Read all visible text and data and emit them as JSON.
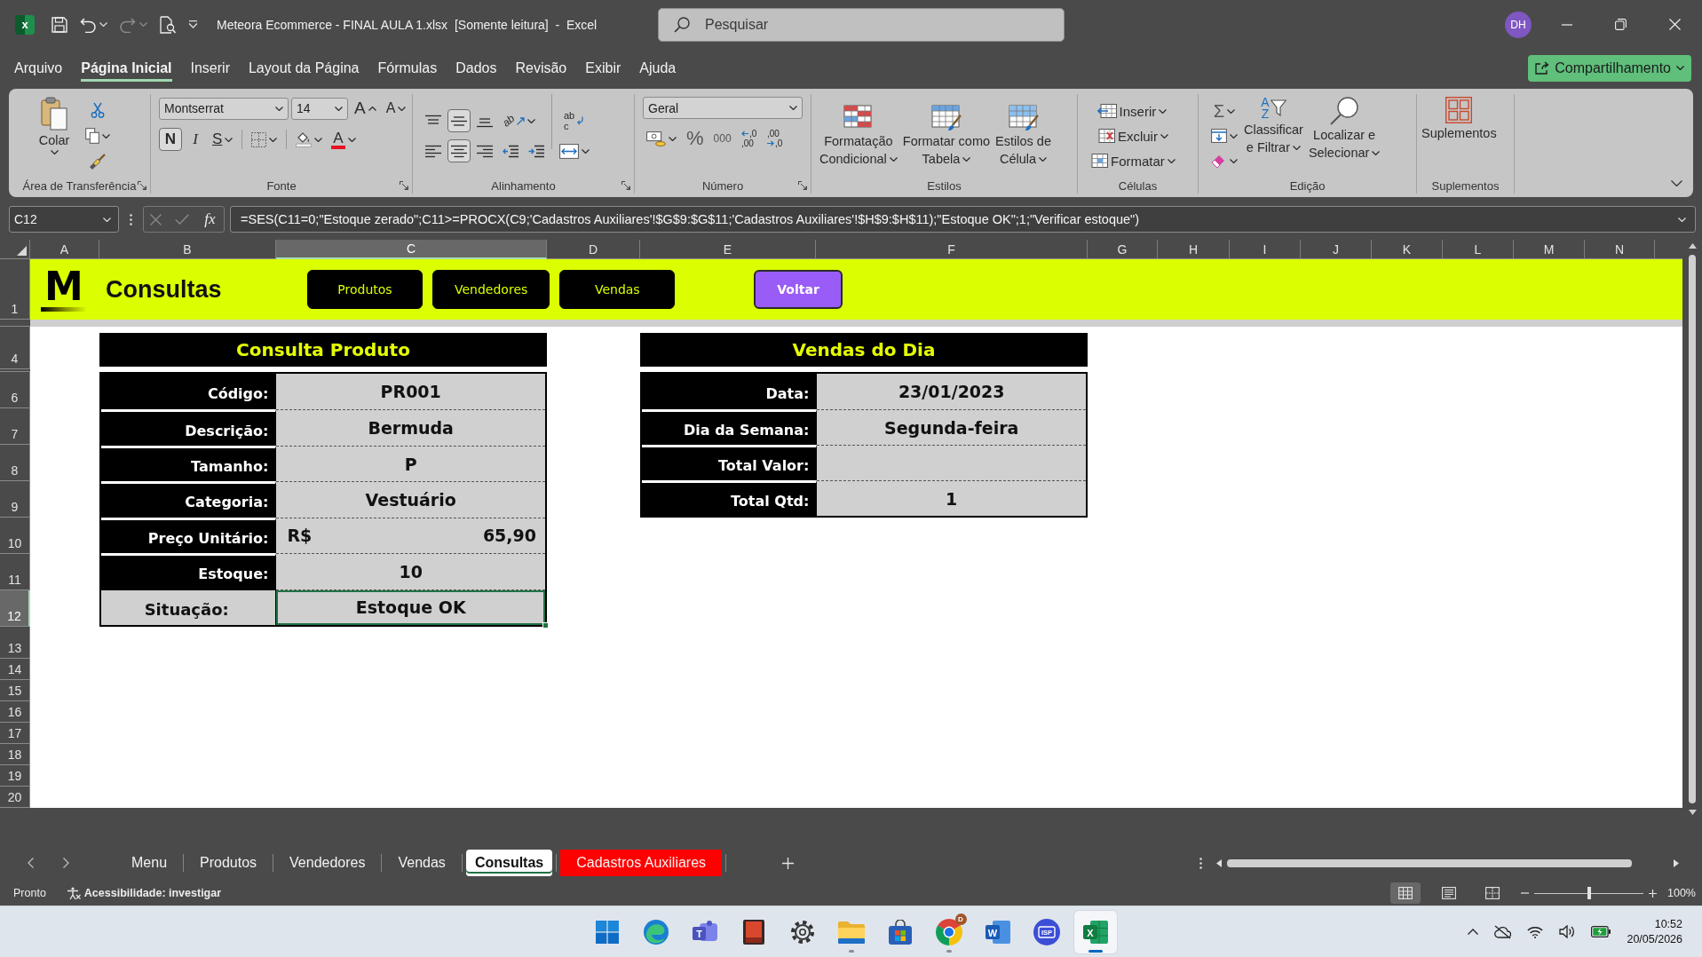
{
  "title_bar": {
    "logo_glyph": "x",
    "redo_disabled": true,
    "title": "Meteora Ecommerce - FINAL AULA 1.xlsx  [Somente leitura]  -  Excel",
    "search": {
      "placeholder": "Pesquisar"
    },
    "avatar": "DH"
  },
  "menu_tabs": [
    {
      "label": "Arquivo",
      "selected": false
    },
    {
      "label": "Página Inicial",
      "selected": true
    },
    {
      "label": "Inserir",
      "selected": false
    },
    {
      "label": "Layout da Página",
      "selected": false
    },
    {
      "label": "Fórmulas",
      "selected": false
    },
    {
      "label": "Dados",
      "selected": false
    },
    {
      "label": "Revisão",
      "selected": false
    },
    {
      "label": "Exibir",
      "selected": false
    },
    {
      "label": "Ajuda",
      "selected": false
    }
  ],
  "share_button": {
    "label": "Compartilhamento"
  },
  "ribbon": {
    "clipboard": {
      "paste_label": "Colar",
      "label": "Área de Transferência"
    },
    "font": {
      "font_name": "Montserrat",
      "font_size": "14",
      "size_glyphs": [
        "A",
        "A"
      ],
      "format_buttons": [
        {
          "glyph": "N",
          "selected": true
        },
        {
          "glyph": "I",
          "selected": false
        },
        {
          "glyph": "S",
          "selected": false
        }
      ],
      "color_glyph": "A",
      "label": "Fonte"
    },
    "alignment": {
      "vertical": [
        {
          "selected": false
        },
        {
          "selected": true
        },
        {
          "selected": false
        }
      ],
      "orientation_glyph": "ab",
      "wrap_glyphs": [
        "ab",
        "c"
      ],
      "horizontal": [
        {
          "selected": false
        },
        {
          "selected": true
        },
        {
          "selected": false
        }
      ],
      "label": "Alinhamento"
    },
    "number": {
      "format": "Geral",
      "percent_glyph": "%",
      "thousands_glyph": "000",
      "decimal_glyphs": [
        [
          ",0",
          ",00"
        ],
        [
          ",00",
          ",0"
        ]
      ],
      "label": "Número"
    },
    "styles": {
      "buttons": [
        {
          "lines": [
            "Formatação",
            "Condicional"
          ]
        },
        {
          "lines": [
            "Formatar como",
            "Tabela"
          ]
        },
        {
          "lines": [
            "Estilos de",
            "Célula"
          ]
        }
      ],
      "label": "Estilos"
    },
    "cells": {
      "buttons": [
        "Inserir",
        "Excluir",
        "Formatar"
      ],
      "label": "Células"
    },
    "editing": {
      "sum_glyph": "Σ",
      "sort_glyphs": [
        "A",
        "Z"
      ],
      "buttons": [
        {
          "lines": [
            "Classificar",
            "e Filtrar"
          ]
        },
        {
          "lines": [
            "Localizar e",
            "Selecionar"
          ]
        }
      ],
      "label": "Edição"
    },
    "addins": {
      "button": "Suplementos",
      "label": "Suplementos"
    }
  },
  "formula_bar": {
    "name_box": "C12",
    "function_glyph": "fx",
    "formula": "=SES(C11=0;\"Estoque zerado\";C11>=PROCX(C9;'Cadastros Auxiliares'!$G$9:$G$11;'Cadastros Auxiliares'!$H$9:$H$11);\"Estoque OK\";1;\"Verificar estoque\")"
  },
  "sheet": {
    "columns": [
      {
        "label": "A",
        "selected": false
      },
      {
        "label": "B",
        "selected": false
      },
      {
        "label": "C",
        "selected": true
      },
      {
        "label": "D",
        "selected": false
      },
      {
        "label": "E",
        "selected": false
      },
      {
        "label": "F",
        "selected": false
      },
      {
        "label": "G",
        "selected": false
      },
      {
        "label": "H",
        "selected": false
      },
      {
        "label": "I",
        "selected": false
      },
      {
        "label": "J",
        "selected": false
      },
      {
        "label": "K",
        "selected": false
      },
      {
        "label": "L",
        "selected": false
      },
      {
        "label": "M",
        "selected": false
      },
      {
        "label": "N",
        "selected": false
      }
    ],
    "rows": [
      {
        "label": "1",
        "selected": false
      },
      {
        "label": "4",
        "selected": false
      },
      {
        "label": "6",
        "selected": false
      },
      {
        "label": "7",
        "selected": false
      },
      {
        "label": "8",
        "selected": false
      },
      {
        "label": "9",
        "selected": false
      },
      {
        "label": "10",
        "selected": false
      },
      {
        "label": "11",
        "selected": false
      },
      {
        "label": "12",
        "selected": true
      },
      {
        "label": "13",
        "selected": false
      },
      {
        "label": "14",
        "selected": false
      },
      {
        "label": "15",
        "selected": false
      },
      {
        "label": "16",
        "selected": false
      },
      {
        "label": "17",
        "selected": false
      },
      {
        "label": "18",
        "selected": false
      },
      {
        "label": "19",
        "selected": false
      },
      {
        "label": "20",
        "selected": false
      }
    ],
    "banner": {
      "logo_glyph": "M",
      "title": "Consultas",
      "buttons": [
        {
          "label": "Produtos",
          "kind": "nav"
        },
        {
          "label": "Vendedores",
          "kind": "nav"
        },
        {
          "label": "Vendas",
          "kind": "nav"
        },
        {
          "label": "Voltar",
          "kind": "back"
        }
      ]
    },
    "product_lookup": {
      "title": "Consulta Produto",
      "rows": [
        {
          "kind": "field",
          "label": "Código:",
          "value": "PR001",
          "selected": false
        },
        {
          "kind": "field",
          "label": "Descrição:",
          "value": "Bermuda",
          "selected": false
        },
        {
          "kind": "field",
          "label": "Tamanho:",
          "value": "P",
          "selected": false
        },
        {
          "kind": "field",
          "label": "Categoria:",
          "value": "Vestuário",
          "selected": false
        },
        {
          "kind": "currency",
          "label": "Preço Unitário:",
          "currency": "R$",
          "value": "65,90",
          "selected": false
        },
        {
          "kind": "field",
          "label": "Estoque:",
          "value": "10",
          "selected": false
        },
        {
          "kind": "result",
          "label": "Situação:",
          "value": "Estoque OK",
          "selected": true
        }
      ]
    },
    "daily_sales": {
      "title": "Vendas do Dia",
      "rows": [
        {
          "kind": "field",
          "label": "Data:",
          "value": "23/01/2023",
          "selected": false
        },
        {
          "kind": "field",
          "label": "Dia da Semana:",
          "value": "Segunda-feira",
          "selected": false
        },
        {
          "kind": "field",
          "label": "Total Valor:",
          "selected": false
        },
        {
          "kind": "field",
          "label": "Total Qtd:",
          "value": "1",
          "selected": false
        }
      ]
    }
  },
  "sheet_tabs": [
    {
      "label": "Menu",
      "selected": false
    },
    {
      "label": "Produtos",
      "selected": false
    },
    {
      "label": "Vendedores",
      "selected": false
    },
    {
      "label": "Vendas",
      "selected": false
    },
    {
      "label": "Consultas",
      "selected": true
    },
    {
      "label": "Cadastros Auxiliares",
      "selected": false,
      "color": "#ff0000"
    }
  ],
  "status_bar": {
    "status": "Pronto",
    "accessibility": "Acessibilidade: investigar",
    "views": [
      {
        "selected": true
      },
      {
        "selected": false
      },
      {
        "selected": false
      }
    ],
    "zoom": {
      "level": 0.5,
      "reading": "100%"
    }
  },
  "taskbar": {
    "apps": [
      {
        "kind": "start",
        "running": false,
        "selected": false
      },
      {
        "kind": "edge",
        "running": false,
        "selected": false
      },
      {
        "kind": "teams",
        "glyph": "T",
        "running": false,
        "selected": false
      },
      {
        "kind": "book",
        "running": false,
        "selected": false
      },
      {
        "kind": "settings",
        "running": false,
        "selected": false
      },
      {
        "kind": "explorer",
        "running": true,
        "selected": false
      },
      {
        "kind": "store",
        "running": false,
        "selected": false
      },
      {
        "kind": "chrome",
        "badge": "D",
        "running": true,
        "selected": false
      },
      {
        "kind": "word",
        "glyph": "W",
        "running": false,
        "selected": false
      },
      {
        "kind": "isp",
        "glyph": "ISP",
        "running": false,
        "selected": false
      },
      {
        "kind": "excel",
        "glyph": "X",
        "running": true,
        "selected": true
      }
    ],
    "time": "10:52",
    "date": "20/05/2026"
  }
}
